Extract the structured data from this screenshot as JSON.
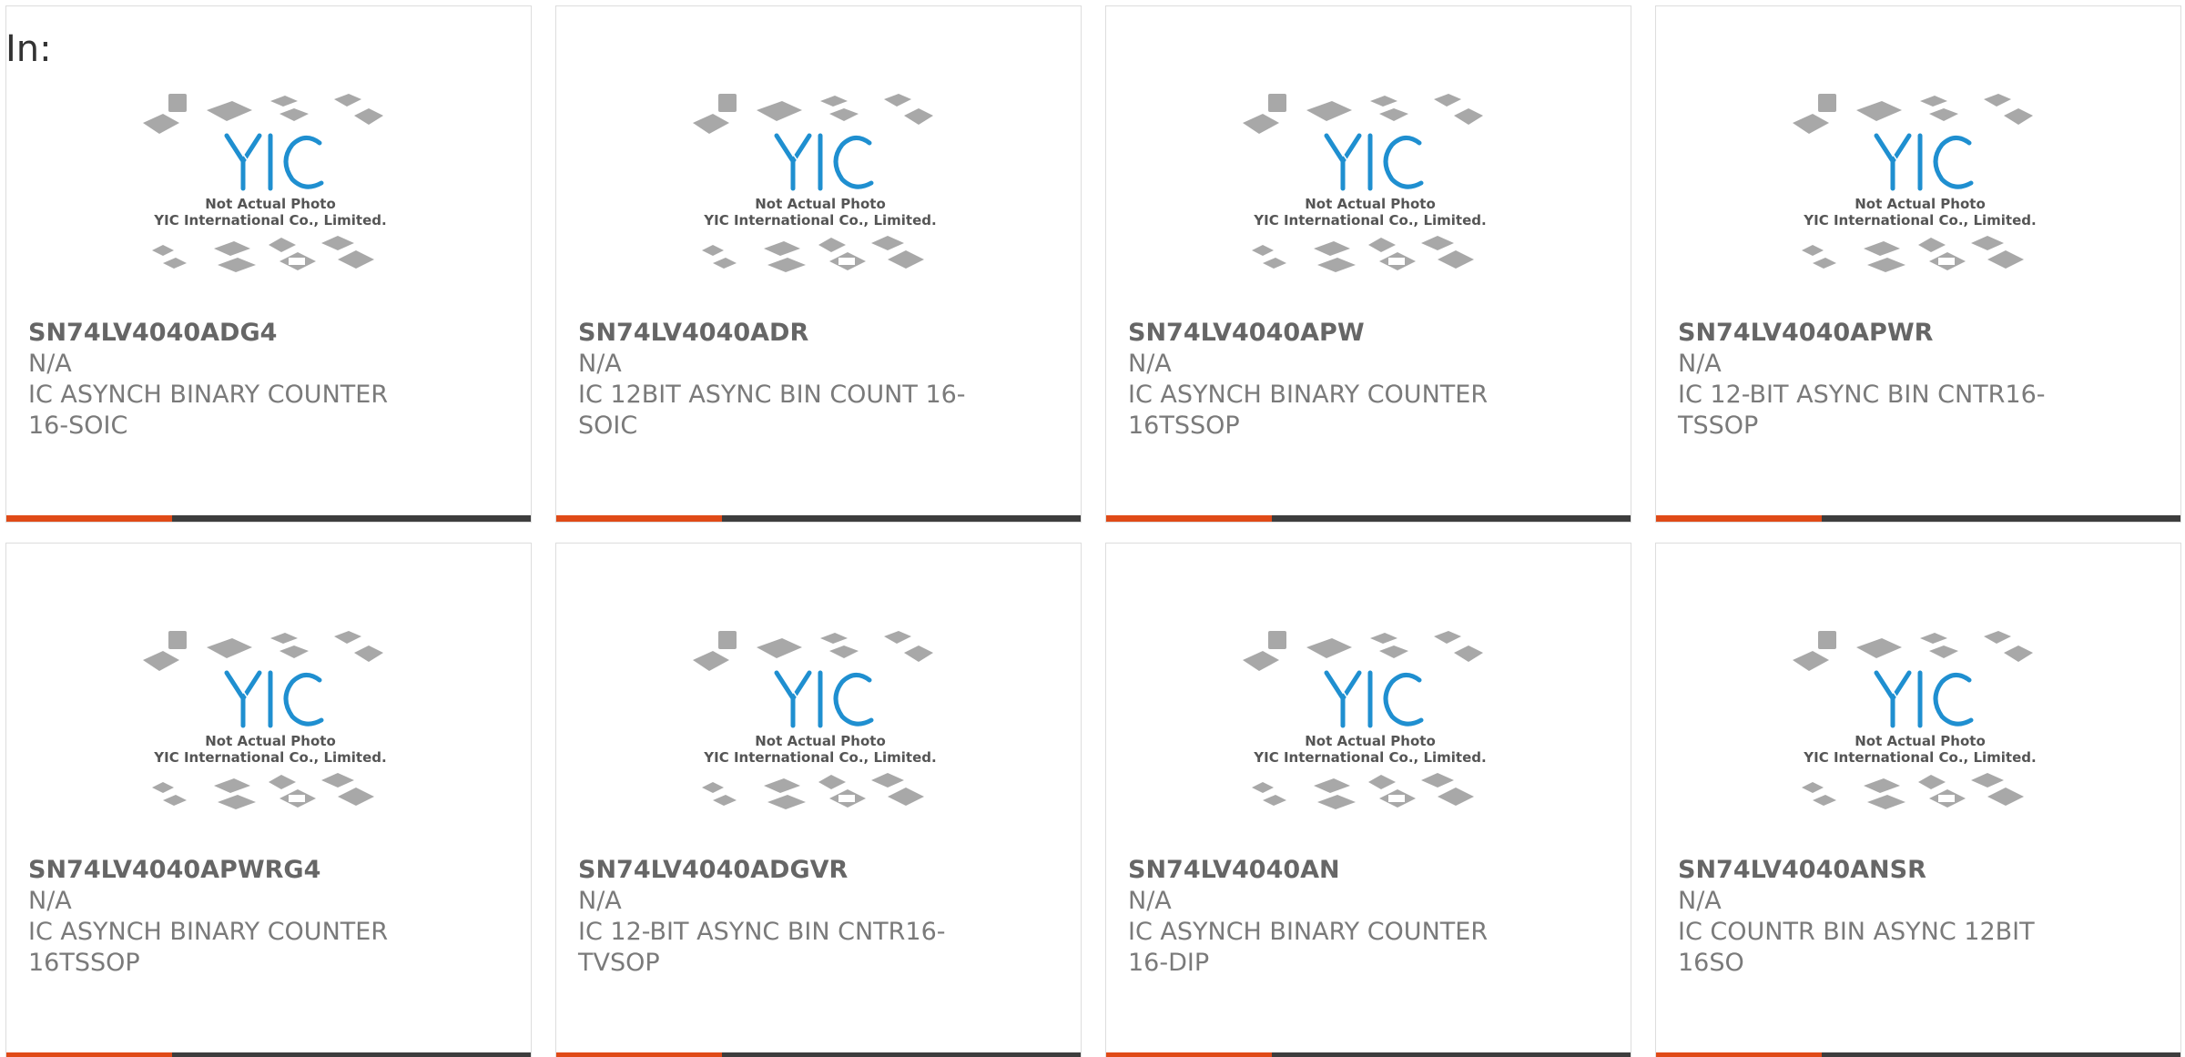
{
  "header": {
    "label": "In:"
  },
  "thumbnail": {
    "caption_line1": "Not Actual Photo",
    "caption_line2": "YIC International Co., Limited.",
    "logo_text": "YIC"
  },
  "colors": {
    "accent": "#e04a17",
    "bar": "#3d3d3d",
    "logo_blue": "#1f8fd0"
  },
  "products": [
    {
      "part_number": "SN74LV4040ADG4",
      "manufacturer": "N/A",
      "description": "IC ASYNCH BINARY COUNTER 16-SOIC"
    },
    {
      "part_number": "SN74LV4040ADR",
      "manufacturer": "N/A",
      "description": "IC 12BIT ASYNC BIN COUNT 16-SOIC"
    },
    {
      "part_number": "SN74LV4040APW",
      "manufacturer": "N/A",
      "description": "IC ASYNCH BINARY COUNTER 16TSSOP"
    },
    {
      "part_number": "SN74LV4040APWR",
      "manufacturer": "N/A",
      "description": "IC 12-BIT ASYNC BIN CNTR16-TSSOP"
    },
    {
      "part_number": "SN74LV4040APWRG4",
      "manufacturer": "N/A",
      "description": "IC ASYNCH BINARY COUNTER 16TSSOP"
    },
    {
      "part_number": "SN74LV4040ADGVR",
      "manufacturer": "N/A",
      "description": "IC 12-BIT ASYNC BIN CNTR16-TVSOP"
    },
    {
      "part_number": "SN74LV4040AN",
      "manufacturer": "N/A",
      "description": "IC ASYNCH BINARY COUNTER 16-DIP"
    },
    {
      "part_number": "SN74LV4040ANSR",
      "manufacturer": "N/A",
      "description": "IC COUNTR BIN ASYNC 12BIT 16SO"
    }
  ]
}
